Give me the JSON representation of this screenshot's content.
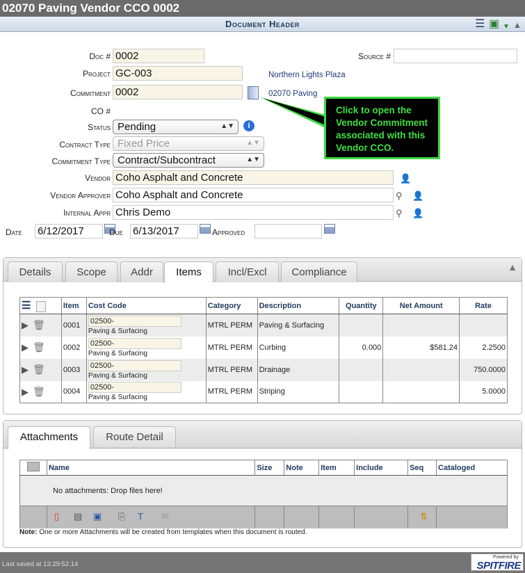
{
  "window": {
    "title": "02070 Paving Vendor CCO 0002"
  },
  "header": {
    "title": "Document Header"
  },
  "form": {
    "doc_label": "Doc #",
    "doc_value": "0002",
    "source_label": "Source #",
    "source_value": "",
    "project_label": "Project",
    "project_value": "GC-003",
    "project_name": "Northern Lights Plaza",
    "commitment_label": "Commitment",
    "commitment_value": "0002",
    "commitment_name": "02070 Paving",
    "co_label": "CO #",
    "status_label": "Status",
    "status_value": "Pending",
    "contract_type_label": "Contract Type",
    "contract_type_value": "Fixed Price",
    "commitment_type_label": "Commitment Type",
    "commitment_type_value": "Contract/Subcontract",
    "vendor_label": "Vendor",
    "vendor_value": "Coho Asphalt and Concrete",
    "vendor_approver_label": "Vendor Approver",
    "vendor_approver_value": "Coho Asphalt and Concrete",
    "internal_appr_label": "Internal Appr",
    "internal_appr_value": "Chris Demo",
    "date_label": "Date",
    "date_value": "6/12/2017",
    "due_label": "Due",
    "due_value": "6/13/2017",
    "approved_label": "Approved",
    "approved_value": ""
  },
  "callout": {
    "text": "Click to open the Vendor Commitment associated with this Vendor CCO."
  },
  "detail_tabs": [
    "Details",
    "Scope",
    "Addr",
    "Items",
    "Incl/Excl",
    "Compliance"
  ],
  "items_table": {
    "headers": [
      "Item",
      "Cost Code",
      "Category",
      "Description",
      "Quantity",
      "Net Amount",
      "Rate"
    ],
    "rows": [
      {
        "item": "0001",
        "cost_code": "02500-",
        "cost_desc": "Paving & Surfacing",
        "category": "MTRL PERM",
        "description": "Paving & Surfacing",
        "quantity": "",
        "net_amount": "",
        "rate": ""
      },
      {
        "item": "0002",
        "cost_code": "02500-",
        "cost_desc": "Paving & Surfacing",
        "category": "MTRL PERM",
        "description": "Curbing",
        "quantity": "0.000",
        "net_amount": "$581.24",
        "rate": "2.2500"
      },
      {
        "item": "0003",
        "cost_code": "02500-",
        "cost_desc": "Paving & Surfacing",
        "category": "MTRL PERM",
        "description": "Drainage",
        "quantity": "",
        "net_amount": "",
        "rate": "750.0000"
      },
      {
        "item": "0004",
        "cost_code": "02500-",
        "cost_desc": "Paving & Surfacing",
        "category": "MTRL PERM",
        "description": "Striping",
        "quantity": "",
        "net_amount": "",
        "rate": "5.0000"
      }
    ]
  },
  "attachment_tabs": [
    "Attachments",
    "Route Detail"
  ],
  "attachments_table": {
    "headers": [
      "Name",
      "Size",
      "Note",
      "Item",
      "Include",
      "Seq",
      "Cataloged"
    ],
    "empty_text": "No attachments: Drop files here!"
  },
  "note": {
    "bold": "Note:",
    "text": " One or more Attachments will be created from templates when this document is routed."
  },
  "footer": {
    "saved": "Last saved at 13:29:52.14",
    "powered_by": "Powered by",
    "brand": "SPITFIRE"
  },
  "colors": {
    "callout_border": "#3fd93f",
    "header_text": "#1f3a5e"
  }
}
